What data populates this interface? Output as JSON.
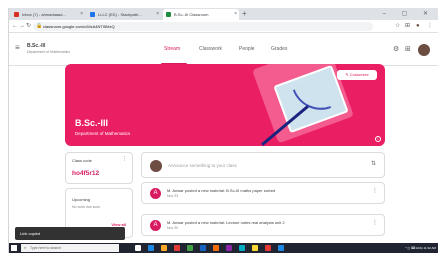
{
  "browser": {
    "tabs": [
      {
        "label": "Inbox (7) - ahmadaaad...",
        "favicon_color": "#d93025"
      },
      {
        "label": "LLLC (ED) - Stackpath...",
        "favicon_color": "#1a73e8"
      },
      {
        "label": "B.Sc.-III Classroom",
        "favicon_color": "#1e8e3e"
      }
    ],
    "new_tab": "+",
    "window_controls": "– ▢ ✕",
    "url": "classroom.google.com/c/MzA4NTI5MzQ",
    "nav": {
      "back": "←",
      "forward": "→",
      "reload": "↻"
    },
    "toolbar_icons": {
      "star": "☆",
      "extensions": "⊞",
      "profile": "●",
      "menu": "⋮"
    }
  },
  "header": {
    "menu": "≡",
    "class_name": "B.Sc.-III",
    "class_subtitle": "Department of Mathematics",
    "tabs": [
      "Stream",
      "Classwork",
      "People",
      "Grades"
    ],
    "active_tab": "Stream",
    "icons": {
      "apps": "⊞",
      "settings": "⚙"
    }
  },
  "banner": {
    "title": "B.Sc.-III",
    "subtitle": "Department of Mathematics",
    "customize": "✎ Customize",
    "info": "i",
    "accent": "#ea1e63"
  },
  "class_code": {
    "label": "Class code",
    "value": "ho4f5r12",
    "menu": "⋮"
  },
  "upcoming": {
    "label": "Upcoming",
    "text": "No work due soon",
    "view_all": "View all"
  },
  "announce": {
    "placeholder": "Announce something to your class",
    "icon": "⇅"
  },
  "posts": [
    {
      "avatar": "A",
      "text": "M. Anwar posted a new material: B.Sc-III maths paper solved",
      "date": "Nov 23",
      "menu": "⋮"
    },
    {
      "avatar": "A",
      "text": "M. Anwar posted a new material: Lecture notes real analysis unit 2",
      "date": "Nov 20",
      "menu": "⋮"
    }
  ],
  "toast": "Link copied",
  "taskbar": {
    "search_placeholder": "Type here to search",
    "search_icon": "⌕",
    "app_colors": [
      "#ffffff",
      "#1e88e5",
      "#f9a825",
      "#e53935",
      "#43a047",
      "#1565c0",
      "#ef6c00",
      "#8e24aa",
      "#00acc1",
      "#fdd835",
      "#e53935",
      "#1e88e5"
    ],
    "tray": "^ ◫ ⌨ ENG 11:32 AM"
  }
}
